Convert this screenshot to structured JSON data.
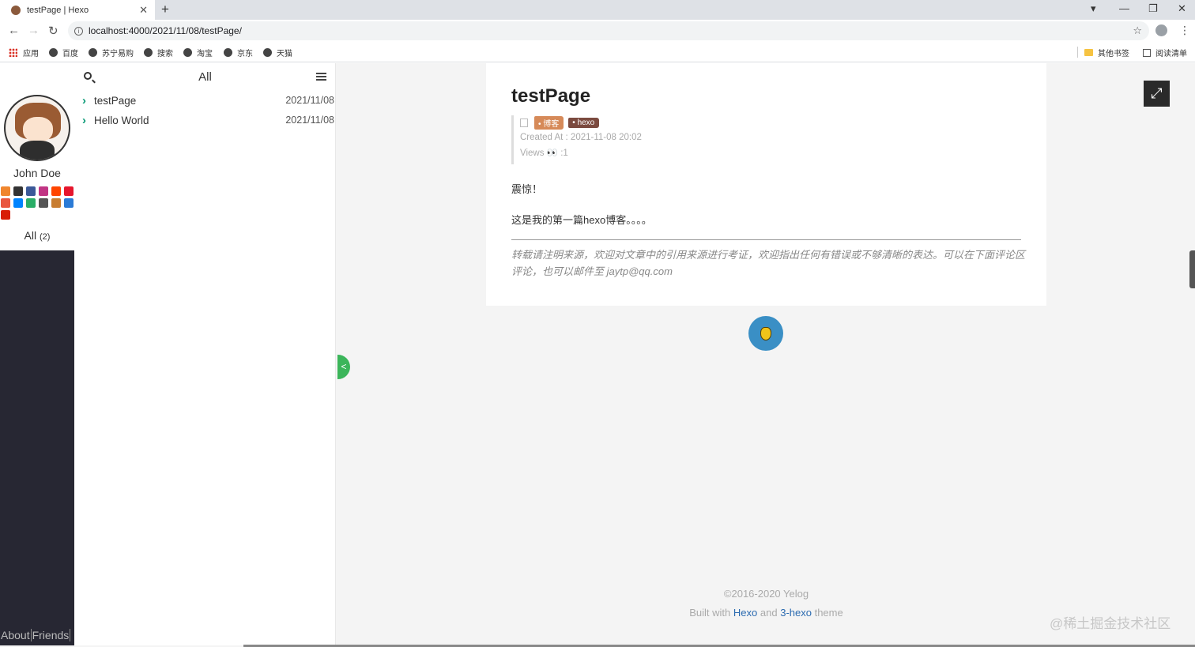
{
  "browser": {
    "tab_title": "testPage | Hexo",
    "tab_close": "✕",
    "new_tab": "+",
    "url": "localhost:4000/2021/11/08/testPage/",
    "bookmarks": [
      "应用",
      "百度",
      "苏宁易购",
      "搜索",
      "淘宝",
      "京东",
      "天猫"
    ],
    "other_bookmarks": "其他书签",
    "reading_list": "阅读清单"
  },
  "sidebar": {
    "name": "John Doe",
    "all_label": "All",
    "all_count": "(2)",
    "footer_links": [
      "About",
      "Friends"
    ],
    "social_colors": [
      "#f0862e",
      "#333333",
      "#3b5998",
      "#c13584",
      "#ff4500",
      "#e6162d",
      "#e9573f",
      "#0084ff",
      "#2aae67",
      "#555555",
      "#c87d31",
      "#2b7bd6",
      "#d81e06"
    ]
  },
  "post_list": {
    "title": "All",
    "posts": [
      {
        "title": "testPage",
        "date": "2021/11/08"
      },
      {
        "title": "Hello World",
        "date": "2021/11/08"
      }
    ]
  },
  "article": {
    "title": "testPage",
    "tags": [
      {
        "label": "博客",
        "color": "#d68a59"
      },
      {
        "label": "hexo",
        "color": "#7b4a3f"
      }
    ],
    "created": "Created At : 2021-11-08 20:02",
    "views_label": "Views",
    "views_count": ":1",
    "paragraphs": [
      "震惊！",
      "这是我的第一篇hexo博客。。。。"
    ],
    "notice": "转载请注明来源，欢迎对文章中的引用来源进行考证，欢迎指出任何有错误或不够清晰的表达。可以在下面评论区评论，也可以邮件至 jaytp@qq.com"
  },
  "toggle_label": "<",
  "footer": {
    "copyright": "©2016-2020 Yelog",
    "built_with": "Built with",
    "hexo": "Hexo",
    "and": "and",
    "theme_name": "3-hexo",
    "theme": "theme"
  },
  "watermark": "@稀土掘金技术社区"
}
